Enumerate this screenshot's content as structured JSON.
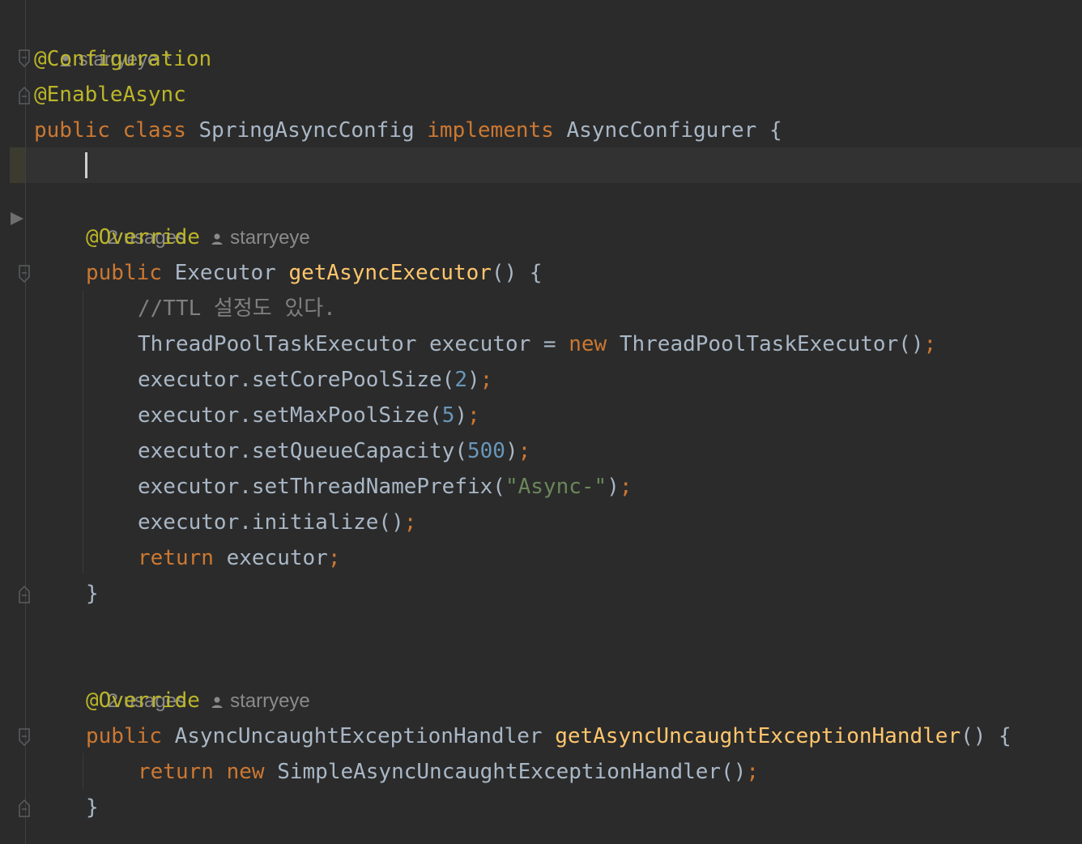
{
  "inlay": {
    "class_author": "starryeye *",
    "method1_usages": "2 usages",
    "method1_author": "starryeye",
    "method2_usages": "2 usages",
    "method2_author": "starryeye"
  },
  "code": {
    "ann_configuration": "@Configuration",
    "ann_enable_async": "@EnableAsync",
    "kw_public": "public",
    "kw_class": "class",
    "class_name": "SpringAsyncConfig",
    "kw_implements": "implements",
    "interface_name": "AsyncConfigurer",
    "open_brace": "{",
    "ann_override": "@Override",
    "type_executor": "Executor",
    "method_get_async_executor": "getAsyncExecutor",
    "parens_brace": "() {",
    "comment_ttl": "//TTL 설정도 있다.",
    "type_thread_pool": "ThreadPoolTaskExecutor",
    "var_executor_assign": " executor = ",
    "kw_new": "new",
    "ctor_thread_pool": "ThreadPoolTaskExecutor()",
    "semicolon": ";",
    "call_set_core": "executor.setCorePoolSize(",
    "num_core": "2",
    "call_set_max": "executor.setMaxPoolSize(",
    "num_max": "5",
    "call_set_queue": "executor.setQueueCapacity(",
    "num_queue": "500",
    "call_set_prefix": "executor.setThreadNamePrefix(",
    "str_prefix": "\"Async-\"",
    "close_paren": ")",
    "call_initialize": "executor.initialize()",
    "kw_return": "return",
    "var_executor": "executor",
    "close_brace": "}",
    "type_handler": "AsyncUncaughtExceptionHandler",
    "method_get_handler": "getAsyncUncaughtExceptionHandler",
    "ctor_simple_handler": "SimpleAsyncUncaughtExceptionHandler()"
  },
  "colors": {
    "background": "#2b2b2b",
    "keyword": "#cc7832",
    "annotation": "#bbb529",
    "method": "#ffc66d",
    "number": "#6897bb",
    "string": "#6a8759",
    "comment": "#808080",
    "text": "#a9b7c6"
  },
  "icons": [
    "person-icon",
    "fold-icon",
    "run-gutter-icon",
    "text-caret"
  ]
}
